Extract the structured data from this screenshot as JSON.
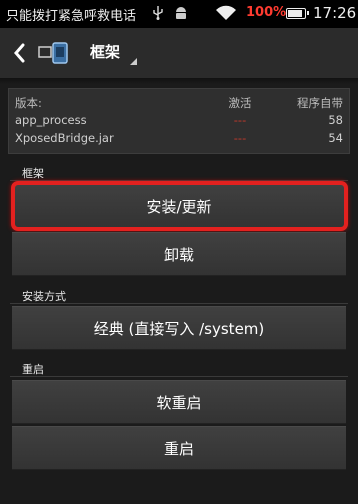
{
  "status_bar": {
    "carrier": "只能拨打紧急呼救电话",
    "battery": "100%",
    "time": "17:26",
    "icons": [
      "usb-icon",
      "android-icon",
      "wifi-icon",
      "battery-icon"
    ]
  },
  "action_bar": {
    "title": "框架",
    "icons": [
      "back-arrow-icon",
      "xposed-app-icon"
    ]
  },
  "info_table": {
    "headers": {
      "name": "版本:",
      "active": "激活",
      "builtin": "程序自带"
    },
    "rows": [
      {
        "name": "app_process",
        "active": "---",
        "builtin": "58"
      },
      {
        "name": "XposedBridge.jar",
        "active": "---",
        "builtin": "54"
      }
    ]
  },
  "framework": {
    "header": "框架",
    "install_label": "安装/更新",
    "uninstall_label": "卸载"
  },
  "install_mode": {
    "header": "安装方式",
    "selected_value": "经典 (直接写入 /system)"
  },
  "reboot": {
    "header": "重启",
    "soft_reboot_label": "软重启",
    "reboot_label": "重启"
  },
  "colors": {
    "highlight": "#e3211f",
    "battery_text": "#ff3b30",
    "inactive_dash": "#c0392b"
  }
}
